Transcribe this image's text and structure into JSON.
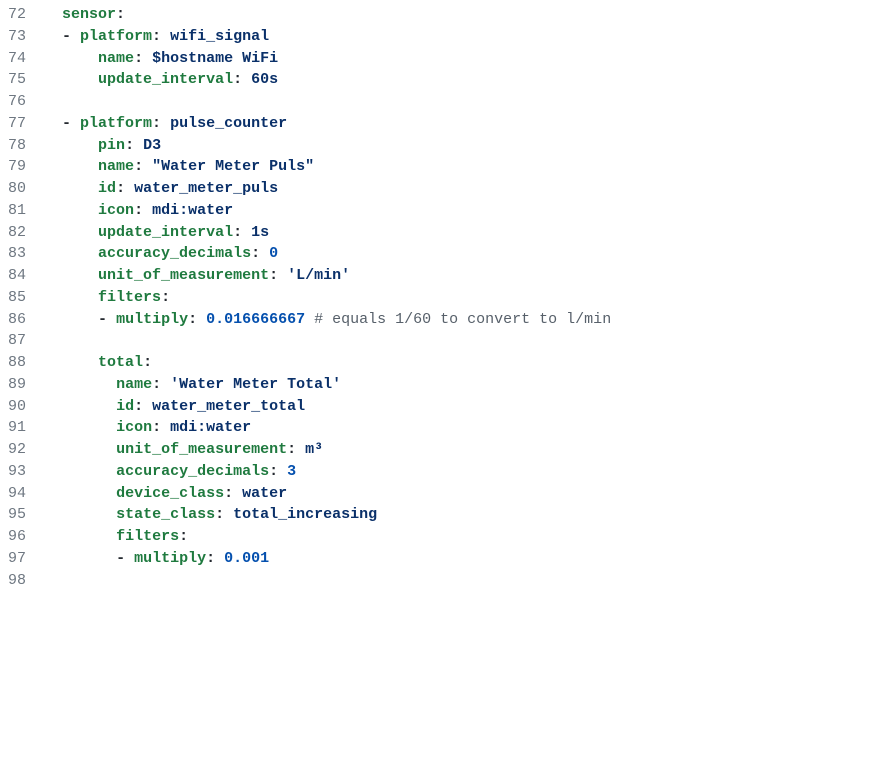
{
  "lines": [
    {
      "num": "72",
      "indent": 1,
      "guides": 0,
      "segments": [
        {
          "cls": "tok-key",
          "t": "sensor"
        },
        {
          "cls": "tok-punc",
          "t": ":"
        }
      ]
    },
    {
      "num": "73",
      "indent": 2,
      "guides": 1,
      "dash": true,
      "segments": [
        {
          "cls": "tok-key",
          "t": "platform"
        },
        {
          "cls": "tok-punc",
          "t": ": "
        },
        {
          "cls": "tok-bare",
          "t": "wifi_signal"
        }
      ]
    },
    {
      "num": "74",
      "indent": 3,
      "guides": 2,
      "segments": [
        {
          "cls": "tok-key",
          "t": "name"
        },
        {
          "cls": "tok-punc",
          "t": ": "
        },
        {
          "cls": "tok-var",
          "t": "$hostname"
        },
        {
          "cls": "tok-bare",
          "t": " WiFi"
        }
      ]
    },
    {
      "num": "75",
      "indent": 3,
      "guides": 2,
      "segments": [
        {
          "cls": "tok-key",
          "t": "update_interval"
        },
        {
          "cls": "tok-punc",
          "t": ": "
        },
        {
          "cls": "tok-bare",
          "t": "60s"
        }
      ]
    },
    {
      "num": "76",
      "indent": 0,
      "guides": 2,
      "segments": []
    },
    {
      "num": "77",
      "indent": 2,
      "guides": 1,
      "dash": true,
      "segments": [
        {
          "cls": "tok-key",
          "t": "platform"
        },
        {
          "cls": "tok-punc",
          "t": ": "
        },
        {
          "cls": "tok-bare",
          "t": "pulse_counter"
        }
      ]
    },
    {
      "num": "78",
      "indent": 3,
      "guides": 2,
      "segments": [
        {
          "cls": "tok-key",
          "t": "pin"
        },
        {
          "cls": "tok-punc",
          "t": ": "
        },
        {
          "cls": "tok-bare",
          "t": "D3"
        }
      ]
    },
    {
      "num": "79",
      "indent": 3,
      "guides": 2,
      "segments": [
        {
          "cls": "tok-key",
          "t": "name"
        },
        {
          "cls": "tok-punc",
          "t": ": "
        },
        {
          "cls": "tok-str",
          "t": "\"Water Meter Puls\""
        }
      ]
    },
    {
      "num": "80",
      "indent": 3,
      "guides": 2,
      "segments": [
        {
          "cls": "tok-key",
          "t": "id"
        },
        {
          "cls": "tok-punc",
          "t": ": "
        },
        {
          "cls": "tok-bare",
          "t": "water_meter_puls"
        }
      ]
    },
    {
      "num": "81",
      "indent": 3,
      "guides": 2,
      "segments": [
        {
          "cls": "tok-key",
          "t": "icon"
        },
        {
          "cls": "tok-punc",
          "t": ": "
        },
        {
          "cls": "tok-bare",
          "t": "mdi:water"
        }
      ]
    },
    {
      "num": "82",
      "indent": 3,
      "guides": 2,
      "segments": [
        {
          "cls": "tok-key",
          "t": "update_interval"
        },
        {
          "cls": "tok-punc",
          "t": ": "
        },
        {
          "cls": "tok-bare",
          "t": "1s"
        }
      ]
    },
    {
      "num": "83",
      "indent": 3,
      "guides": 2,
      "segments": [
        {
          "cls": "tok-key",
          "t": "accuracy_decimals"
        },
        {
          "cls": "tok-punc",
          "t": ": "
        },
        {
          "cls": "tok-num",
          "t": "0"
        }
      ]
    },
    {
      "num": "84",
      "indent": 3,
      "guides": 2,
      "segments": [
        {
          "cls": "tok-key",
          "t": "unit_of_measurement"
        },
        {
          "cls": "tok-punc",
          "t": ": "
        },
        {
          "cls": "tok-str",
          "t": "'L/min'"
        }
      ]
    },
    {
      "num": "85",
      "indent": 3,
      "guides": 2,
      "segments": [
        {
          "cls": "tok-key",
          "t": "filters"
        },
        {
          "cls": "tok-punc",
          "t": ":"
        }
      ]
    },
    {
      "num": "86",
      "indent": 4,
      "guides": 3,
      "dash": true,
      "segments": [
        {
          "cls": "tok-key",
          "t": "multiply"
        },
        {
          "cls": "tok-punc",
          "t": ": "
        },
        {
          "cls": "tok-num",
          "t": "0.016666667"
        },
        {
          "cls": "",
          "t": " "
        },
        {
          "cls": "tok-com",
          "t": "# equals 1/60 to convert to l/min"
        }
      ]
    },
    {
      "num": "87",
      "indent": 0,
      "guides": 2,
      "segments": []
    },
    {
      "num": "88",
      "indent": 3,
      "guides": 2,
      "segments": [
        {
          "cls": "tok-key",
          "t": "total"
        },
        {
          "cls": "tok-punc",
          "t": ":"
        }
      ]
    },
    {
      "num": "89",
      "indent": 4,
      "guides": 3,
      "segments": [
        {
          "cls": "tok-key",
          "t": "name"
        },
        {
          "cls": "tok-punc",
          "t": ": "
        },
        {
          "cls": "tok-str",
          "t": "'Water Meter Total'"
        }
      ]
    },
    {
      "num": "90",
      "indent": 4,
      "guides": 3,
      "segments": [
        {
          "cls": "tok-key",
          "t": "id"
        },
        {
          "cls": "tok-punc",
          "t": ": "
        },
        {
          "cls": "tok-bare",
          "t": "water_meter_total"
        }
      ]
    },
    {
      "num": "91",
      "indent": 4,
      "guides": 3,
      "segments": [
        {
          "cls": "tok-key",
          "t": "icon"
        },
        {
          "cls": "tok-punc",
          "t": ": "
        },
        {
          "cls": "tok-bare",
          "t": "mdi:water"
        }
      ]
    },
    {
      "num": "92",
      "indent": 4,
      "guides": 3,
      "segments": [
        {
          "cls": "tok-key",
          "t": "unit_of_measurement"
        },
        {
          "cls": "tok-punc",
          "t": ": "
        },
        {
          "cls": "tok-bare",
          "t": "m³"
        }
      ]
    },
    {
      "num": "93",
      "indent": 4,
      "guides": 3,
      "segments": [
        {
          "cls": "tok-key",
          "t": "accuracy_decimals"
        },
        {
          "cls": "tok-punc",
          "t": ": "
        },
        {
          "cls": "tok-num",
          "t": "3"
        }
      ]
    },
    {
      "num": "94",
      "indent": 4,
      "guides": 3,
      "segments": [
        {
          "cls": "tok-key",
          "t": "device_class"
        },
        {
          "cls": "tok-punc",
          "t": ": "
        },
        {
          "cls": "tok-bare",
          "t": "water"
        }
      ]
    },
    {
      "num": "95",
      "indent": 4,
      "guides": 3,
      "segments": [
        {
          "cls": "tok-key",
          "t": "state_class"
        },
        {
          "cls": "tok-punc",
          "t": ": "
        },
        {
          "cls": "tok-bare",
          "t": "total_increasing"
        }
      ]
    },
    {
      "num": "96",
      "indent": 4,
      "guides": 3,
      "segments": [
        {
          "cls": "tok-key",
          "t": "filters"
        },
        {
          "cls": "tok-punc",
          "t": ":"
        }
      ]
    },
    {
      "num": "97",
      "indent": 5,
      "guides": 4,
      "dash": true,
      "segments": [
        {
          "cls": "tok-key",
          "t": "multiply"
        },
        {
          "cls": "tok-punc",
          "t": ": "
        },
        {
          "cls": "tok-num",
          "t": "0.001"
        }
      ]
    },
    {
      "num": "98",
      "indent": 0,
      "guides": 2,
      "segments": []
    }
  ]
}
